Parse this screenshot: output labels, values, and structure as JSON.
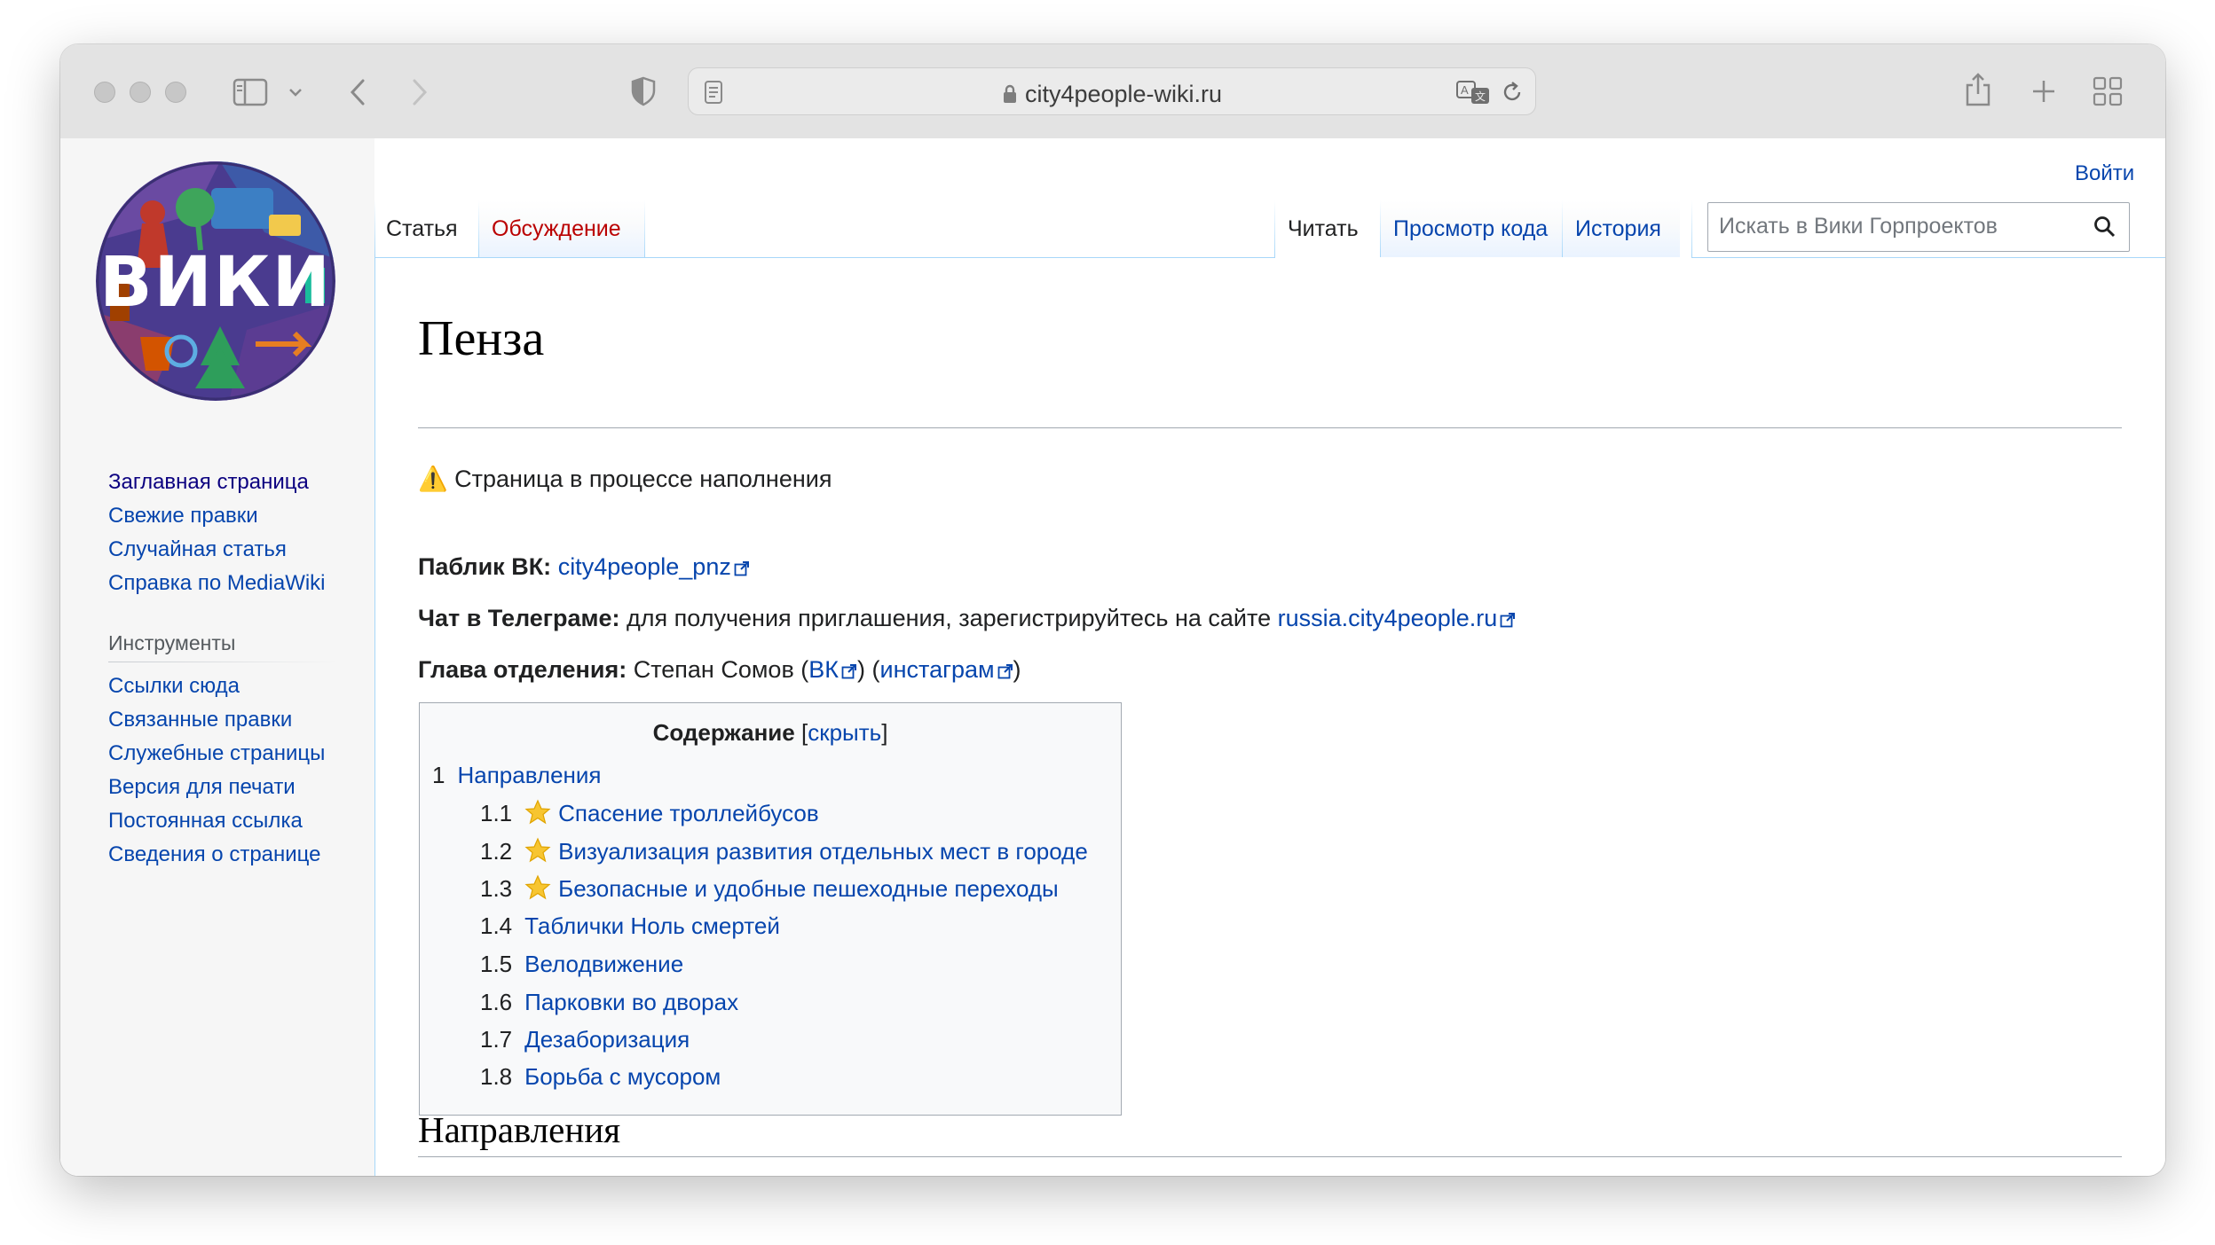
{
  "browser": {
    "url": "city4people-wiki.ru"
  },
  "header": {
    "login": "Войти"
  },
  "logo": {
    "text": "ВИКИ"
  },
  "tabs": {
    "left": [
      "Статья",
      "Обсуждение"
    ],
    "right": [
      "Читать",
      "Просмотр кода",
      "История"
    ]
  },
  "search": {
    "placeholder": "Искать в Вики Горпроектов"
  },
  "sidebar": {
    "nav": [
      "Заглавная страница",
      "Свежие правки",
      "Случайная статья",
      "Справка по MediaWiki"
    ],
    "tools_heading": "Инструменты",
    "tools": [
      "Ссылки сюда",
      "Связанные правки",
      "Служебные страницы",
      "Версия для печати",
      "Постоянная ссылка",
      "Сведения о странице"
    ]
  },
  "article": {
    "title": "Пенза",
    "notice_icon": "⚠️",
    "notice": "Страница в процессе наполнения",
    "vk_label": "Паблик ВК:",
    "vk_link": "city4people_pnz",
    "tg_label": "Чат в Телеграме:",
    "tg_text": "для получения приглашения, зарегистрируйтесь на сайте",
    "tg_link": "russia.city4people.ru",
    "head_label": "Глава отделения:",
    "head_name": "Степан Сомов",
    "head_vk": "ВК",
    "head_insta": "инстаграм",
    "section_title": "Направления"
  },
  "toc": {
    "title": "Содержание",
    "toggle": "скрыть",
    "items": [
      {
        "num": "1",
        "text": "Направления",
        "star": false
      },
      {
        "num": "1.1",
        "text": "Спасение троллейбусов",
        "star": true
      },
      {
        "num": "1.2",
        "text": "Визуализация развития отдельных мест в городе",
        "star": true
      },
      {
        "num": "1.3",
        "text": "Безопасные и удобные пешеходные переходы",
        "star": true
      },
      {
        "num": "1.4",
        "text": "Таблички Ноль смертей",
        "star": false
      },
      {
        "num": "1.5",
        "text": "Велодвижение",
        "star": false
      },
      {
        "num": "1.6",
        "text": "Парковки во дворах",
        "star": false
      },
      {
        "num": "1.7",
        "text": "Дезаборизация",
        "star": false
      },
      {
        "num": "1.8",
        "text": "Борьба с мусором",
        "star": false
      }
    ]
  },
  "colors": {
    "link": "#0645ad",
    "link_visited": "#0b0080",
    "link_new": "#ba0000",
    "tab_border": "#a7d7f9",
    "toolbar": "#e3e3e3"
  }
}
